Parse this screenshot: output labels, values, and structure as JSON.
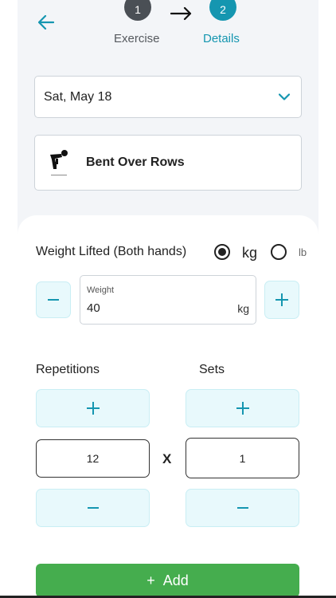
{
  "stepper": {
    "step1_number": "1",
    "step1_label": "Exercise",
    "step2_number": "2",
    "step2_label": "Details"
  },
  "date": {
    "value": "Sat, May 18"
  },
  "exercise": {
    "name": "Bent Over Rows"
  },
  "weight": {
    "section_label": "Weight Lifted (Both hands)",
    "unit_kg_label": "kg",
    "unit_lb_label": "lb",
    "selected_unit": "kg",
    "field_label": "Weight",
    "value": "40",
    "field_unit": "kg"
  },
  "reps": {
    "label": "Repetitions",
    "value": "12"
  },
  "sets": {
    "label": "Sets",
    "value": "1"
  },
  "multiply_symbol": "X",
  "add_button": {
    "icon": "+",
    "label": "Add"
  },
  "colors": {
    "accent": "#1596b0",
    "primary_button": "#45ad4e",
    "soft_button": "#e8f9fc",
    "background": "#f3f5f8"
  },
  "icons": [
    "back-arrow-icon",
    "arrow-right-icon",
    "chevron-down-icon",
    "exercise-figure-icon",
    "plus-icon",
    "minus-icon"
  ]
}
